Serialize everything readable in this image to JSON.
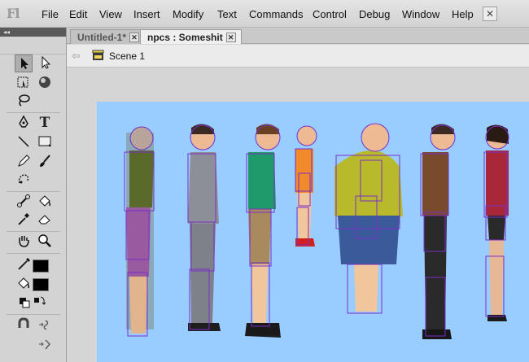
{
  "app": {
    "logo": "Fl",
    "close_label": "✕"
  },
  "menu": [
    "File",
    "Edit",
    "View",
    "Insert",
    "Modify",
    "Text",
    "Commands",
    "Control",
    "Debug",
    "Window",
    "Help"
  ],
  "tools_panel": {
    "collapse_label": "◂◂"
  },
  "tabs": [
    {
      "label": "Untitled-1*",
      "active": false
    },
    {
      "label": "npcs : Someshit",
      "active": true
    }
  ],
  "editbar": {
    "scene": "Scene 1"
  },
  "colors": {
    "stage": "#99ccff",
    "bounding_box": "#7b2fc8",
    "stroke_swatch": "#000000",
    "fill_swatch": "#000000"
  },
  "icons": [
    "selection-tool-icon",
    "subselection-tool-icon",
    "free-transform-tool-icon",
    "3d-rotation-tool-icon",
    "lasso-tool-icon",
    "pen-tool-icon",
    "text-tool-icon",
    "line-tool-icon",
    "rectangle-tool-icon",
    "pencil-tool-icon",
    "brush-tool-icon",
    "deco-tool-icon",
    "bone-tool-icon",
    "paint-bucket-tool-icon",
    "eyedropper-tool-icon",
    "eraser-tool-icon",
    "hand-tool-icon",
    "zoom-tool-icon",
    "stroke-color-icon",
    "fill-color-icon",
    "black-white-icon",
    "swap-colors-icon",
    "snap-to-objects-icon",
    "smooth-icon",
    "straighten-icon"
  ],
  "stage_content": {
    "characters": [
      "zombie",
      "businessman",
      "young-man",
      "child",
      "obese-man",
      "man-in-brown-shirt",
      "woman"
    ]
  }
}
